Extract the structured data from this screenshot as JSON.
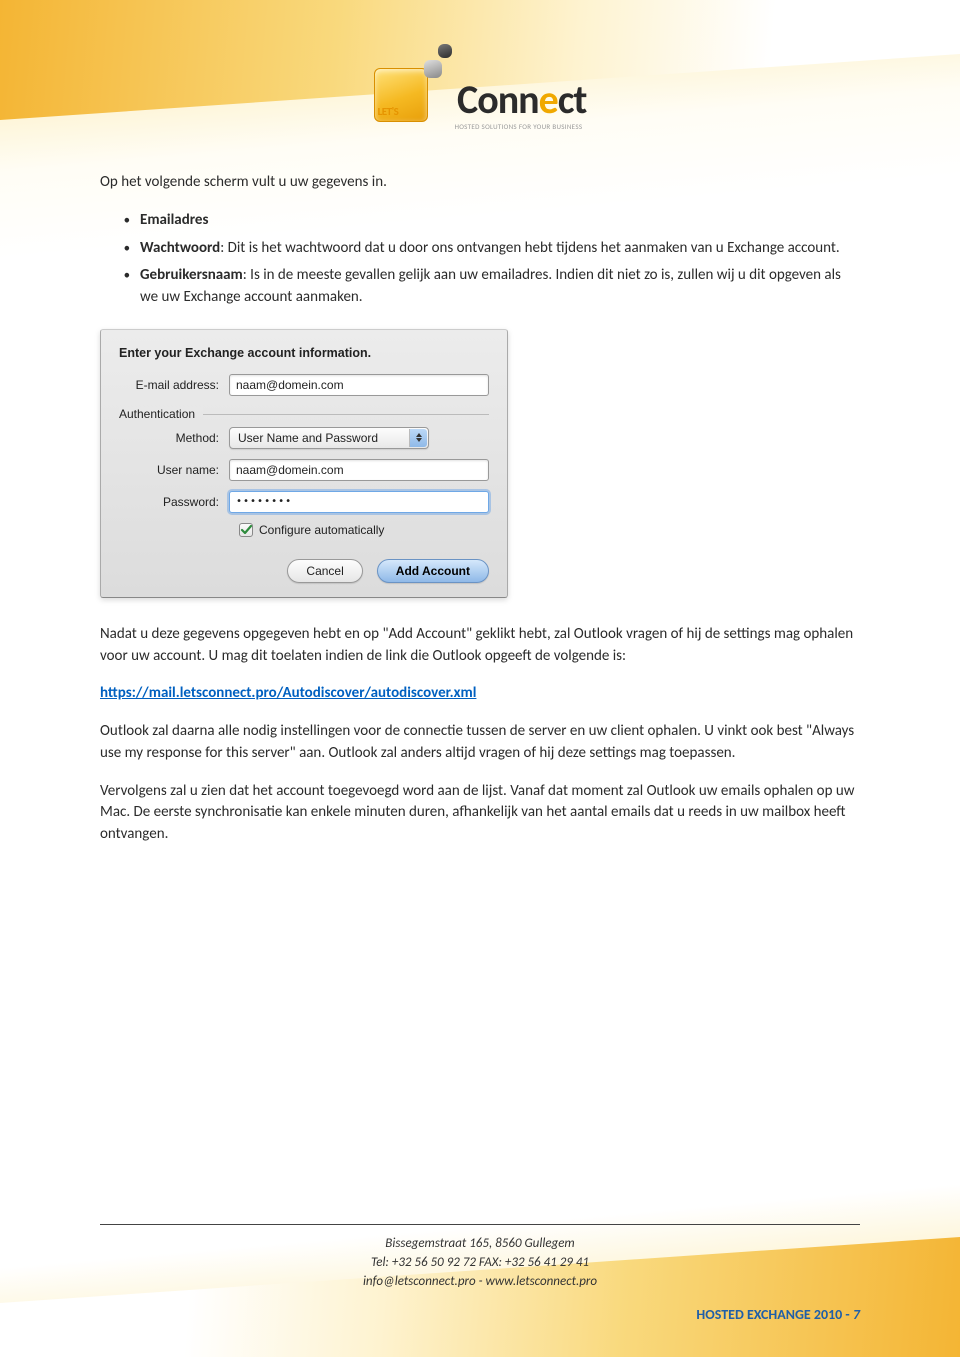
{
  "logo": {
    "lets": "LET'S",
    "conn": "Conn",
    "e": "e",
    "ct": "ct",
    "tagline": "HOSTED SOLUTIONS FOR YOUR BUSINESS"
  },
  "intro": "Op het volgende scherm vult u uw gegevens in.",
  "bullets": {
    "b1_label": "Emailadres",
    "b2_label": "Wachtwoord",
    "b2_text": ": Dit is het wachtwoord dat u door ons ontvangen hebt tijdens het aanmaken van u Exchange account.",
    "b3_label": "Gebruikersnaam",
    "b3_text": ": Is in de meeste gevallen gelijk aan uw emailadres. Indien dit niet zo is, zullen wij u dit opgeven als we uw Exchange account aanmaken."
  },
  "dialog": {
    "title": "Enter your Exchange account information.",
    "email_label": "E-mail address:",
    "email_value": "naam@domein.com",
    "auth_legend": "Authentication",
    "method_label": "Method:",
    "method_value": "User Name and Password",
    "username_label": "User name:",
    "username_value": "naam@domein.com",
    "password_label": "Password:",
    "password_value": "••••••••",
    "configure_label": "Configure automatically",
    "cancel": "Cancel",
    "add": "Add Account"
  },
  "para2": "Nadat u deze gegevens opgegeven hebt en op \"Add Account\" geklikt hebt, zal Outlook vragen of hij de settings mag ophalen voor uw account. U mag dit toelaten indien de link die Outlook opgeeft de volgende is:",
  "link": "https://mail.letsconnect.pro/Autodiscover/autodiscover.xml",
  "para3": "Outlook zal daarna alle nodig instellingen voor de connectie tussen de server en uw client ophalen. U vinkt ook best \"Always use my response for this server\" aan. Outlook zal anders altijd vragen of hij deze settings mag toepassen.",
  "para4": "Vervolgens zal u zien dat het account toegevoegd word aan de lijst. Vanaf dat moment zal Outlook uw emails ophalen op uw Mac. De eerste synchronisatie kan enkele minuten duren, afhankelijk van het aantal emails dat u reeds in uw mailbox heeft ontvangen.",
  "footer": {
    "line1": "Bissegemstraat 165, 8560 Gullegem",
    "line2": "Tel: +32 56 50 92 72  FAX: +32 56 41 29 41",
    "line3": "info@letsconnect.pro - www.letsconnect.pro",
    "doc": "HOSTED EXCHANGE 2010 - ",
    "page": "7"
  }
}
